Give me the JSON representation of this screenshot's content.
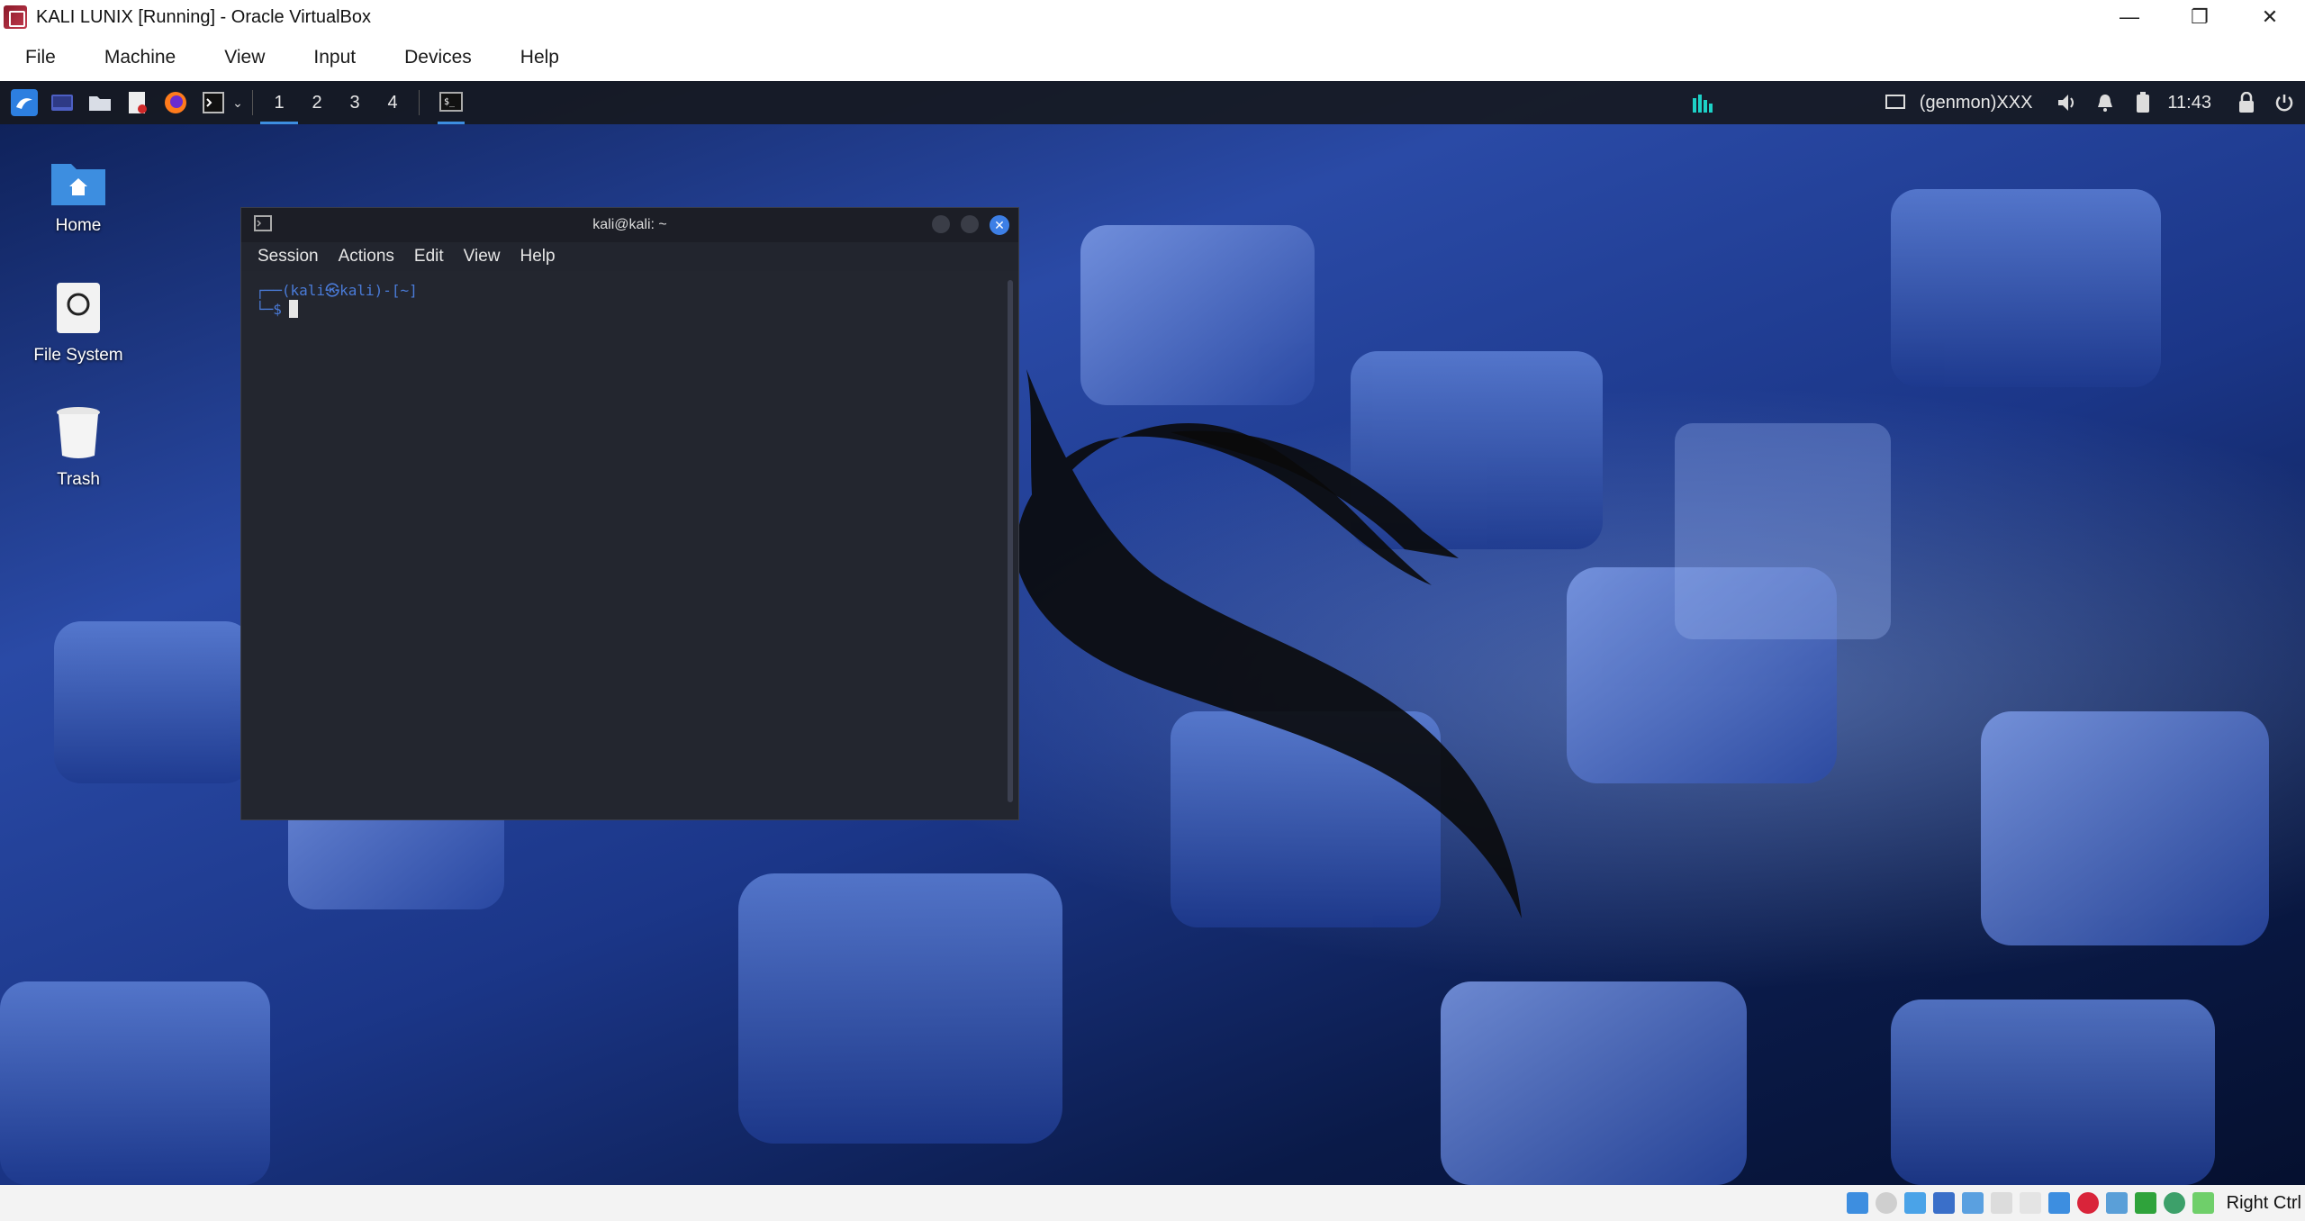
{
  "host": {
    "title": "KALI LUNIX [Running] - Oracle VirtualBox",
    "controls": {
      "minimize": "—",
      "restore": "❐",
      "close": "✕"
    },
    "menu": [
      "File",
      "Machine",
      "View",
      "Input",
      "Devices",
      "Help"
    ],
    "status": {
      "host_key": "Right Ctrl"
    }
  },
  "panel": {
    "workspaces": [
      "1",
      "2",
      "3",
      "4"
    ],
    "active_workspace": "1",
    "user_label": "(genmon)XXX",
    "clock": "11:43"
  },
  "desktop": {
    "icons": [
      {
        "label": "Home",
        "icon": "home-icon"
      },
      {
        "label": "File System",
        "icon": "drive-icon"
      },
      {
        "label": "Trash",
        "icon": "trash-icon"
      }
    ]
  },
  "terminal": {
    "title": "kali@kali: ~",
    "menu": [
      "Session",
      "Actions",
      "Edit",
      "View",
      "Help"
    ],
    "prompt_line1": "┌──(kali㉿kali)-[~]",
    "prompt_line2": "└─$"
  },
  "colors": {
    "panel_bg": "#161921",
    "accent": "#3d8ee0",
    "terminal_bg": "#23262f",
    "prompt": "#4a7bd8",
    "close_button": "#3d7fe6"
  }
}
